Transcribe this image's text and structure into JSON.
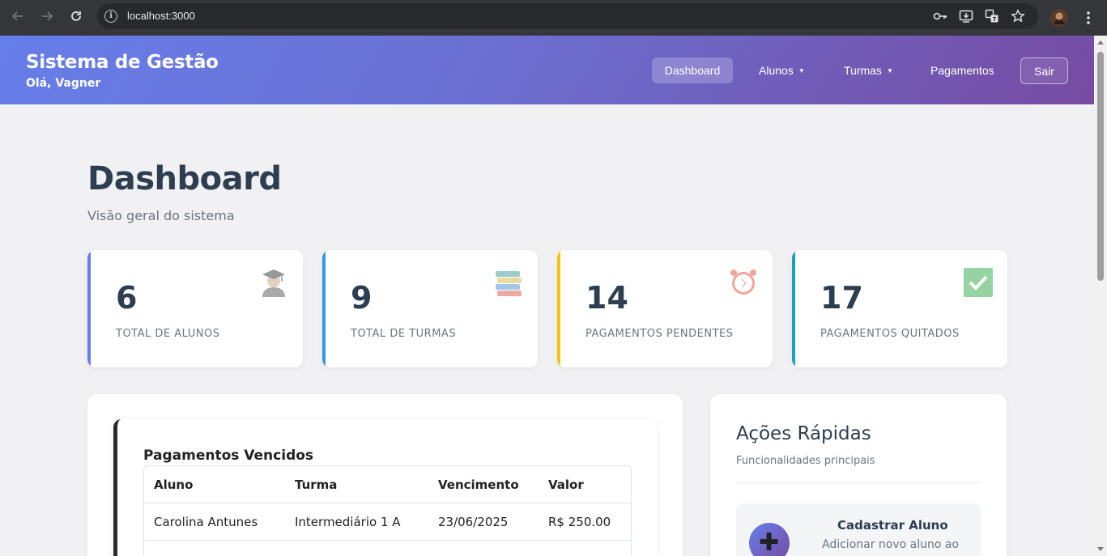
{
  "browser": {
    "url": "localhost:3000"
  },
  "header": {
    "brand": "Sistema de Gestão",
    "greeting": "Olá, Vagner",
    "nav": [
      {
        "label": "Dashboard",
        "active": true
      },
      {
        "label": "Alunos",
        "dropdown": true
      },
      {
        "label": "Turmas",
        "dropdown": true
      },
      {
        "label": "Pagamentos"
      }
    ],
    "logout_label": "Sair"
  },
  "page": {
    "title": "Dashboard",
    "subtitle": "Visão geral do sistema"
  },
  "stats": [
    {
      "value": "6",
      "label": "TOTAL DE ALUNOS",
      "icon": "student-icon",
      "color": "#667eea"
    },
    {
      "value": "9",
      "label": "TOTAL DE TURMAS",
      "icon": "books-icon",
      "color": "#3498db"
    },
    {
      "value": "14",
      "label": "PAGAMENTOS PENDENTES",
      "icon": "alarm-clock-icon",
      "color": "#f1c40f"
    },
    {
      "value": "17",
      "label": "PAGAMENTOS QUITADOS",
      "icon": "check-mark-icon",
      "color": "#17a2b8"
    }
  ],
  "overdue": {
    "title": "Pagamentos Vencidos",
    "columns": [
      "Aluno",
      "Turma",
      "Vencimento",
      "Valor"
    ],
    "rows": [
      [
        "Carolina Antunes",
        "Intermediário 1 A",
        "23/06/2025",
        "R$ 250.00"
      ]
    ]
  },
  "quick_actions": {
    "title": "Ações Rápidas",
    "subtitle": "Funcionalidades principais",
    "items": [
      {
        "title": "Cadastrar Aluno",
        "description": "Adicionar novo aluno ao",
        "icon": "plus-icon"
      }
    ]
  }
}
